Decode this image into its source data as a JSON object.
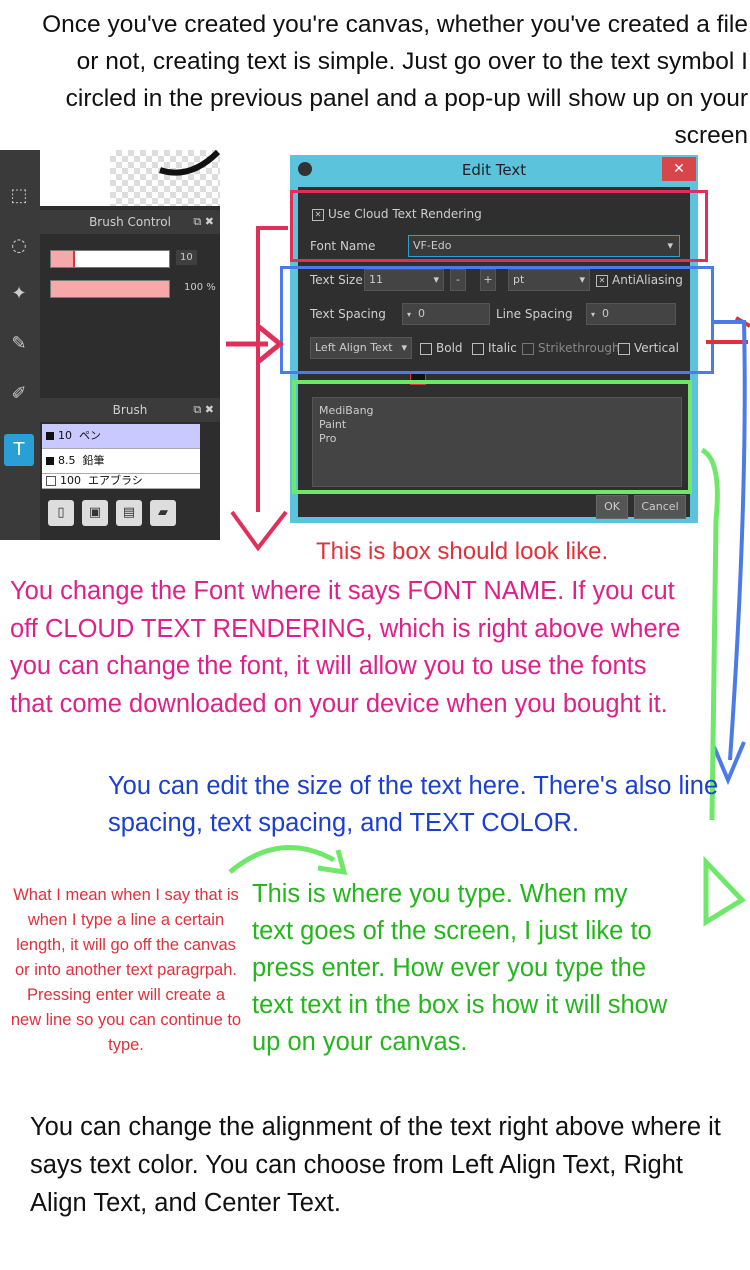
{
  "intro_text": "Once you've created you're canvas, whether you've created a file or not, creating text is simple. Just go over to the text symbol I circled in the previous panel and a pop-up will show up on your screen",
  "left_panel": {
    "brush_control_title": "Brush Control",
    "brush_size_value": "10",
    "brush_opacity_value": "100 %",
    "brush_title": "Brush",
    "brushes": [
      {
        "size": "10",
        "name": "ペン"
      },
      {
        "size": "8.5",
        "name": "鉛筆"
      },
      {
        "size": "100",
        "name": "エアブラシ"
      }
    ],
    "text_tool_glyph": "T"
  },
  "dialog": {
    "title": "Edit Text",
    "close_label": "✕",
    "cloud_rendering_label": "Use Cloud Text Rendering",
    "font_name_label": "Font Name",
    "font_name_value": "VF-Edo",
    "text_size_label": "Text Size",
    "text_size_value": "11",
    "minus_label": "-",
    "plus_label": "+",
    "unit_value": "pt",
    "antialiasing_label": "AntiAliasing",
    "text_spacing_label": "Text Spacing",
    "text_spacing_value": "0",
    "line_spacing_label": "Line Spacing",
    "line_spacing_value": "0",
    "align_value": "Left Align Text",
    "bold_label": "Bold",
    "italic_label": "Italic",
    "strikethrough_label": "Strikethrough",
    "vertical_label": "Vertical",
    "text_lines": [
      "MediBang",
      "Paint",
      "Pro"
    ],
    "ok_label": "OK",
    "cancel_label": "Cancel"
  },
  "notes": {
    "box_look": "This is box should look like.",
    "font_note": "You change the Font where it says FONT NAME. If you cut off CLOUD TEXT RENDERING, which is right above where you can change the font, it will allow you to use the fonts that come downloaded on your device when you bought it.",
    "size_note": "You can edit the size of the text here. There's also line spacing, text spacing, and TEXT COLOR.",
    "line_note": "What I mean when I say that is when I type a line a certain length, it will go off the canvas or into another text paragrpah. Pressing enter will create a new line so you can continue to type.",
    "type_note": "This is where you type. When my text goes of the screen, I just like to press enter. How ever you type the text text in the box is how it will show up on your canvas.",
    "align_note": "You can change the alignment of the text right above where it says text color. You can choose from Left Align Text, Right Align Text, and Center Text."
  },
  "colors": {
    "red": "#e0303a",
    "pink": "#e0208a",
    "blue": "#1b3fcf",
    "green": "#25b61e",
    "dialog_frame": "#5bc3dc"
  }
}
